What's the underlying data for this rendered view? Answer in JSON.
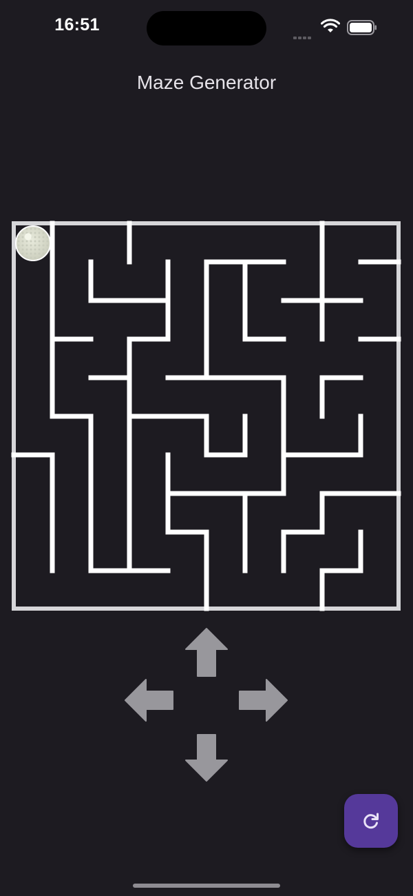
{
  "status_bar": {
    "time": "16:51",
    "signal_icon": "cellular-dots-icon",
    "wifi_icon": "wifi-icon",
    "battery_icon": "battery-icon"
  },
  "header": {
    "title": "Maze Generator"
  },
  "maze": {
    "rows": 10,
    "cols": 10,
    "player_cell": [
      0,
      0
    ],
    "wall_color": "#ffffff",
    "background_color": "#1d1b21",
    "player_icon": "golf-ball-icon"
  },
  "controls": {
    "up_icon": "arrow-up-icon",
    "left_icon": "arrow-left-icon",
    "right_icon": "arrow-right-icon",
    "down_icon": "arrow-down-icon",
    "arrow_color": "#98979c"
  },
  "fab": {
    "icon": "refresh-icon",
    "color": "#55399a"
  }
}
